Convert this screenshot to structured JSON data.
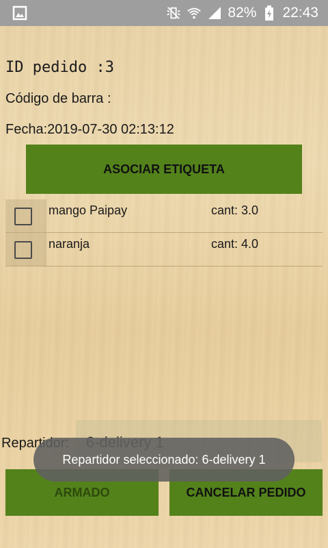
{
  "status_bar": {
    "battery": "82%",
    "time": "22:43",
    "icons": [
      "image-icon",
      "vibrate-mute-icon",
      "wifi-icon",
      "signal-icon",
      "battery-charging-icon"
    ]
  },
  "order": {
    "id_line": "ID pedido :3",
    "barcode_line": "Código de barra :",
    "date_line": "Fecha:2019-07-30 02:13:12"
  },
  "actions": {
    "associate_label": "ASOCIAR ETIQUETA",
    "armado_label": "ARMADO",
    "cancel_label": "CANCELAR PEDIDO"
  },
  "items": [
    {
      "name": "mango Paipay",
      "qty": "cant: 3.0",
      "checked": false
    },
    {
      "name": "naranja",
      "qty": "cant: 4.0",
      "checked": false
    }
  ],
  "delivery": {
    "label": "Repartidor:",
    "selected": "6-delivery 1"
  },
  "toast": {
    "message": "Repartidor seleccionado: 6-delivery 1"
  },
  "colors": {
    "accent_green": "#53821b",
    "status_bar": "#9e9e9e",
    "toast": "#606060"
  }
}
